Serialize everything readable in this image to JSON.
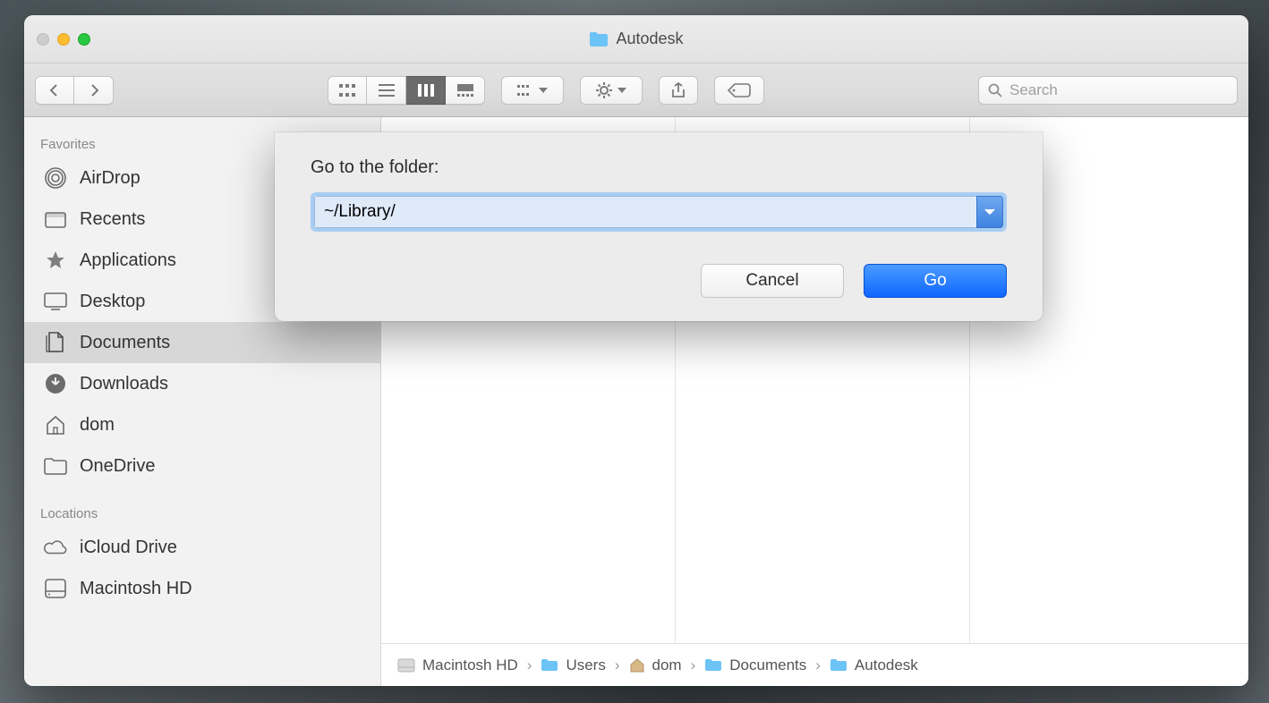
{
  "window": {
    "title": "Autodesk"
  },
  "toolbar": {
    "search_placeholder": "Search"
  },
  "sidebar": {
    "favorites_header": "Favorites",
    "locations_header": "Locations",
    "favorites": [
      {
        "label": "AirDrop"
      },
      {
        "label": "Recents"
      },
      {
        "label": "Applications"
      },
      {
        "label": "Desktop"
      },
      {
        "label": "Documents"
      },
      {
        "label": "Downloads"
      },
      {
        "label": "dom"
      },
      {
        "label": "OneDrive"
      }
    ],
    "locations": [
      {
        "label": "iCloud Drive"
      },
      {
        "label": "Macintosh HD"
      }
    ]
  },
  "pathbar": {
    "items": [
      {
        "label": "Macintosh HD"
      },
      {
        "label": "Users"
      },
      {
        "label": "dom"
      },
      {
        "label": "Documents"
      },
      {
        "label": "Autodesk"
      }
    ]
  },
  "sheet": {
    "label": "Go to the folder:",
    "value": "~/Library/",
    "cancel": "Cancel",
    "go": "Go"
  }
}
